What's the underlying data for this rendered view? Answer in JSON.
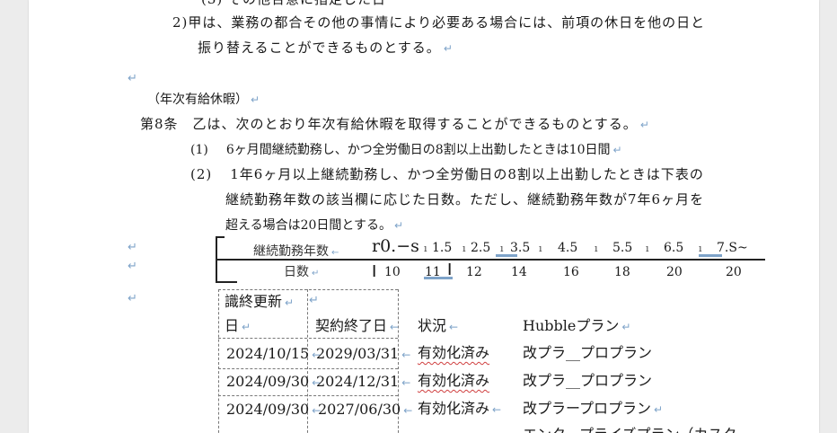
{
  "document": {
    "top_partial": "(3) その他合意に指定した日",
    "para2": "2)甲は、業務の都合その他の事情により必要ある場合には、前項の休日を他の日と",
    "para2_cont": "振り替えることができるものとする。",
    "heading": "（年次有給休暇）",
    "article_label": "第8条",
    "article_text": "乙は、次のとおり年次有給休暇を取得することができるものとする。",
    "item1_num": "(1)",
    "item1_text": "6ヶ月間継続勤務し、かつ全労働日の8割以上出勤したときは10日間",
    "item2_num": "(2)",
    "item2_line1": "1年6ヶ月以上継続勤務し、かつ全労働日の8割以上出勤したときは下表の",
    "item2_line2": "継続勤務年数の該当欄に応じた日数。ただし、継続勤務年数が7年6ヶ月を",
    "item2_line3": "超える場合は20日間とする。",
    "paragraph_mark": "↵",
    "tab_mark": "←"
  },
  "leave_table": {
    "row1_label": "継続勤務年数",
    "row1_values": [
      "r0.−s",
      "1.5",
      "2.5",
      "3.5",
      "4.5",
      "5.5",
      "6.5",
      "7.S~"
    ],
    "row2_label": "日数",
    "row2_values": [
      "10",
      "11",
      "12",
      "14",
      "16",
      "18",
      "20",
      "20"
    ]
  },
  "contract_table": {
    "headers": {
      "renewal_line1": "識終更新",
      "renewal_line2": "日",
      "end": "契約終了日",
      "status": "状況",
      "plan": "Hubbleプラン"
    },
    "rows": [
      {
        "renewal": "2024/10/15",
        "end": "2029/03/31",
        "status": "有効化済み",
        "plan": "改プラ__プロプラン"
      },
      {
        "renewal": "2024/09/30",
        "end": "2024/12/31",
        "status": "有効化済み",
        "plan": "改プラ__プロプラン"
      },
      {
        "renewal": "2024/09/30",
        "end": "2027/06/30",
        "status": "有効化済み",
        "plan": "改プラープロプラン"
      }
    ],
    "partial_row_plan": "エンタープライズプラン（カスタ"
  }
}
